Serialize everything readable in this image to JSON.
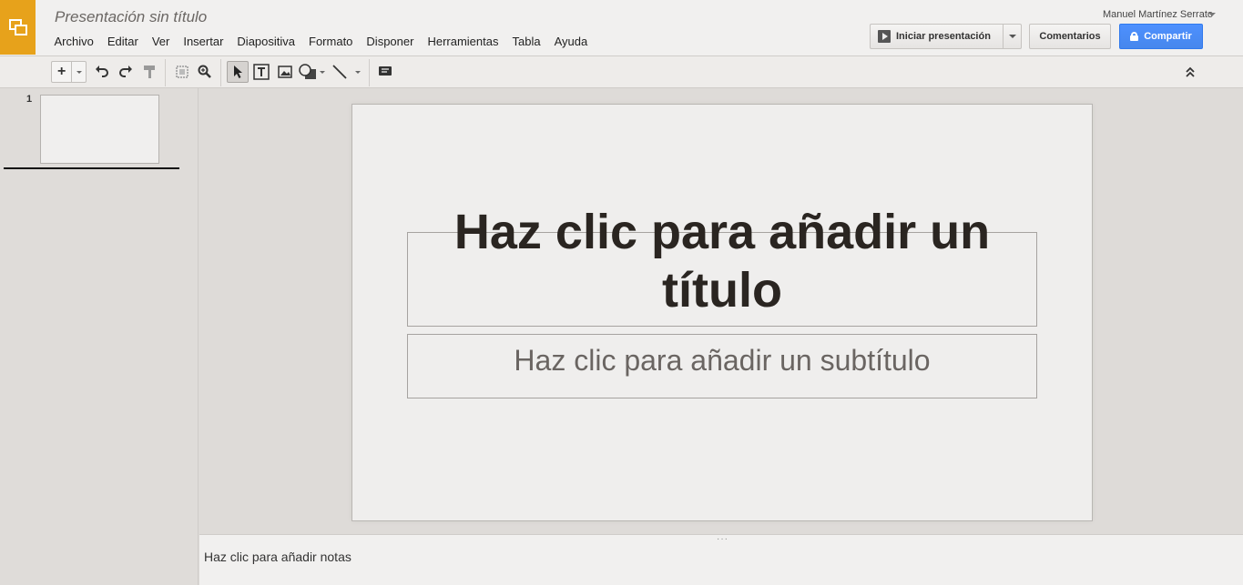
{
  "app": {
    "doc_title": "Presentación sin título",
    "user_name": "Manuel Martínez Serrato",
    "logo_color": "#e7a21b"
  },
  "menu": [
    "Archivo",
    "Editar",
    "Ver",
    "Insertar",
    "Diapositiva",
    "Formato",
    "Disponer",
    "Herramientas",
    "Tabla",
    "Ayuda"
  ],
  "buttons": {
    "present_label": "Iniciar presentación",
    "comments_label": "Comentarios",
    "share_label": "Compartir",
    "share_color": "#4d90fe"
  },
  "toolbar": {
    "icons": [
      "new-slide-icon",
      "undo-icon",
      "redo-icon",
      "paint-format-icon",
      "fit-icon",
      "zoom-icon",
      "select-icon",
      "text-box-icon",
      "image-icon",
      "shape-icon",
      "line-icon",
      "comment-icon",
      "collapse-icon"
    ]
  },
  "filmstrip": {
    "slides": [
      {
        "number": "1"
      }
    ]
  },
  "slide": {
    "title_placeholder": "Haz clic para añadir un título",
    "subtitle_placeholder": "Haz clic para añadir un subtítulo"
  },
  "notes": {
    "placeholder": "Haz clic para añadir notas",
    "grip": "···"
  }
}
